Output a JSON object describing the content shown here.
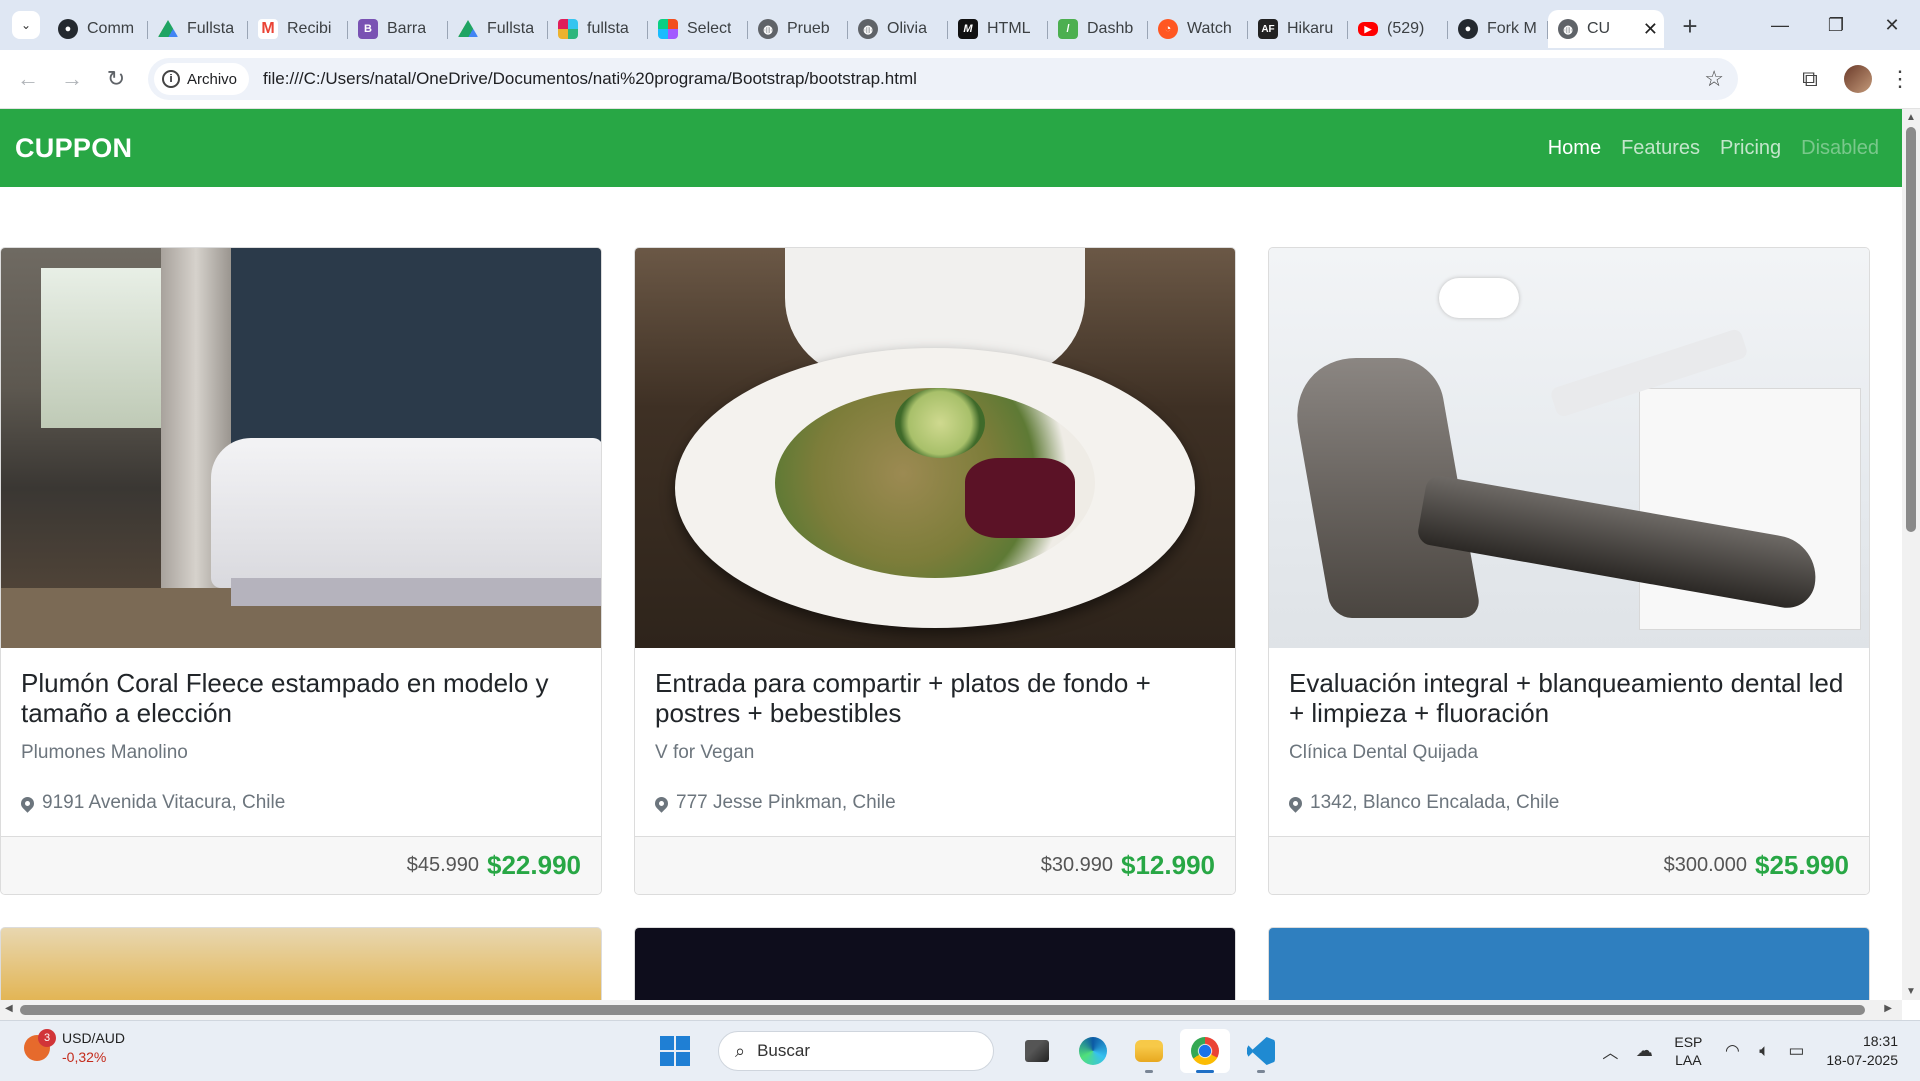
{
  "browser": {
    "tabs": [
      {
        "title": "Comm",
        "icon": "github-icon",
        "color": "#24292f"
      },
      {
        "title": "Fullsta",
        "icon": "google-drive-icon",
        "color": "#1fa463"
      },
      {
        "title": "Recibi",
        "icon": "gmail-icon",
        "color": "#ea4335"
      },
      {
        "title": "Barra",
        "icon": "bootstrap-icon",
        "color": "#7952b3"
      },
      {
        "title": "Fullsta",
        "icon": "google-drive-icon",
        "color": "#1fa463"
      },
      {
        "title": "fullsta",
        "icon": "slack-icon",
        "color": "#e01e5a"
      },
      {
        "title": "Select",
        "icon": "figma-icon",
        "color": "#0acf83"
      },
      {
        "title": "Prueb",
        "icon": "globe-icon",
        "color": "#5f6368"
      },
      {
        "title": "Olivia",
        "icon": "globe-icon",
        "color": "#5f6368"
      },
      {
        "title": "HTML",
        "icon": "mdn-icon",
        "color": "#111111"
      },
      {
        "title": "Dashb",
        "icon": "dashboard-icon",
        "color": "#4caf50"
      },
      {
        "title": "Watch",
        "icon": "watch-icon",
        "color": "#ff5722"
      },
      {
        "title": "Hikaru",
        "icon": "af-icon",
        "color": "#222222"
      },
      {
        "title": "(529)",
        "icon": "youtube-icon",
        "color": "#ff0000"
      },
      {
        "title": "Fork M",
        "icon": "github-icon",
        "color": "#24292f"
      }
    ],
    "active_tab": {
      "title": "CU",
      "icon": "globe-icon",
      "close": "✕"
    },
    "new_tab": "+",
    "address": {
      "chip_label": "Archivo",
      "url": "file:///C:/Users/natal/OneDrive/Documentos/nati%20programa/Bootstrap/bootstrap.html"
    }
  },
  "page": {
    "brand": "CUPPON",
    "nav": [
      {
        "label": "Home",
        "state": "active"
      },
      {
        "label": "Features",
        "state": "normal"
      },
      {
        "label": "Pricing",
        "state": "normal"
      },
      {
        "label": "Disabled",
        "state": "disabled"
      }
    ],
    "cards": [
      {
        "image": "bedroom-photo",
        "title": "Plumón Coral Fleece estampado en modelo y tamaño a elección",
        "vendor": "Plumones Manolino",
        "address": "9191 Avenida Vitacura, Chile",
        "old_price": "$45.990",
        "new_price": "$22.990"
      },
      {
        "image": "food-plate-photo",
        "title": "Entrada para compartir + platos de fondo + postres + bebestibles",
        "vendor": "V for Vegan",
        "address": "777 Jesse Pinkman, Chile",
        "old_price": "$30.990",
        "new_price": "$12.990"
      },
      {
        "image": "dental-chair-photo",
        "title": "Evaluación integral + blanqueamiento dental led + limpieza + fluoración",
        "vendor": "Clínica Dental Quijada",
        "address": "1342, Blanco Encalada, Chile",
        "old_price": "$300.000",
        "new_price": "$25.990"
      }
    ],
    "colors": {
      "navbar": "#28a745",
      "price": "#28a745"
    }
  },
  "taskbar": {
    "widget": {
      "label": "USD/AUD",
      "change": "-0,32%",
      "badge": "3"
    },
    "search_placeholder": "Buscar",
    "apps": [
      "task-view-icon",
      "edge-icon",
      "file-explorer-icon",
      "chrome-icon",
      "vscode-icon"
    ],
    "language": {
      "line1": "ESP",
      "line2": "LAA"
    },
    "clock": {
      "time": "18:31",
      "date": "18-07-2025"
    }
  }
}
